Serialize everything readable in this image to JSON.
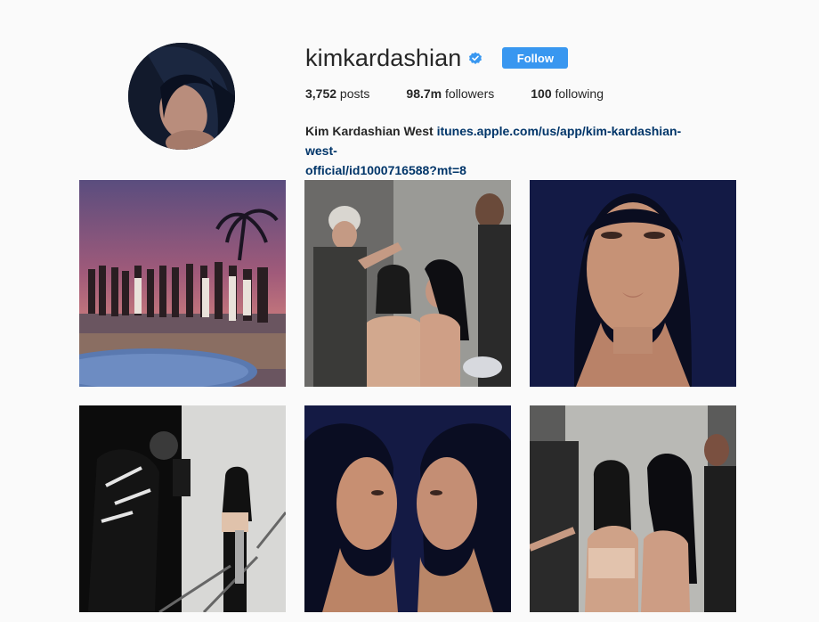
{
  "profile": {
    "username": "kimkardashian",
    "verified": true,
    "follow_label": "Follow",
    "stats": {
      "posts_count": "3,752",
      "posts_label": " posts",
      "followers_count": "98.7m",
      "followers_label": " followers",
      "following_count": "100",
      "following_label": " following"
    },
    "bio": {
      "full_name": "Kim Kardashian West",
      "link_line1": "itunes.apple.com/us/app/kim-kardashian-west-",
      "link_line2": "official/id1000716588?mt=8"
    }
  },
  "colors": {
    "follow_button": "#3897f0",
    "verified_badge": "#3897f0",
    "link": "#003569",
    "background": "#fafafa"
  },
  "icons": {
    "verified": "verified-badge-icon"
  }
}
